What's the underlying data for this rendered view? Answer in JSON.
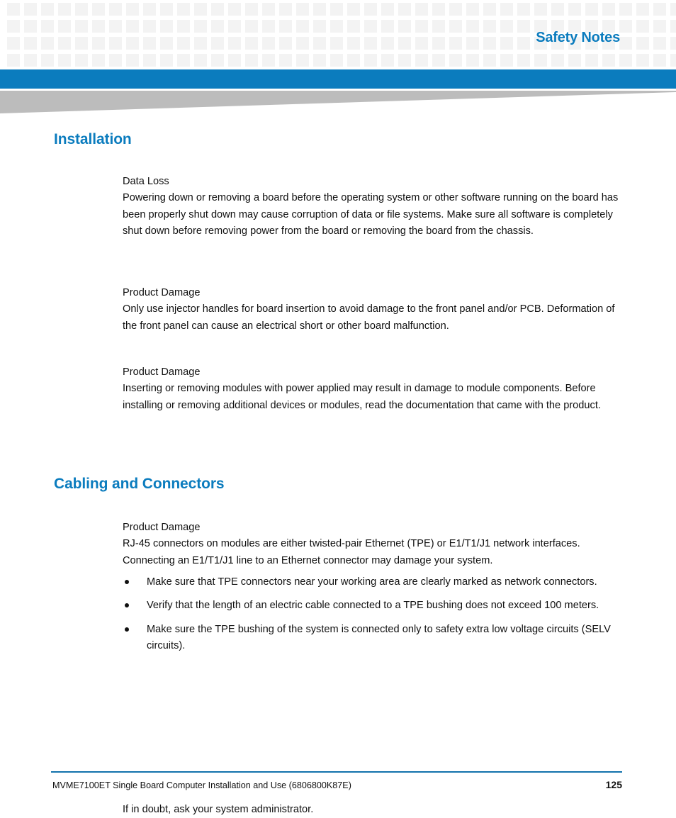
{
  "document": {
    "running_head": "Safety Notes",
    "accent_color": "#0b7cbe",
    "checker_color": "#f3f3f3",
    "wedge_color": "#bcbcbc"
  },
  "sections": [
    {
      "heading": "Installation",
      "notes": [
        {
          "title": "Data Loss",
          "body": "Powering down or removing a board before the operating system or other software running on the board has been properly shut down may cause corruption of data or file systems. Make sure all software is completely shut down before removing power from the board or removing the board from the chassis."
        },
        {
          "title": "Product Damage",
          "body": "Only use injector handles for board insertion to avoid damage to the front panel and/or PCB. Deformation of the front panel can cause an electrical short or other board malfunction."
        },
        {
          "title": "Product Damage",
          "body": "Inserting or removing modules with power applied may result in damage to module components. Before installing or removing additional devices or modules, read the documentation that came with the product."
        }
      ]
    },
    {
      "heading": "Cabling and Connectors",
      "notes": [
        {
          "title": "Product Damage",
          "body": "RJ-45 connectors on modules are either twisted-pair Ethernet (TPE) or E1/T1/J1 network interfaces. Connecting an E1/T1/J1 line to an Ethernet connector may damage your system."
        }
      ],
      "bullets": [
        "Make sure that TPE connectors near your working area are clearly marked as network connectors.",
        "Verify that the length of an electric cable connected to a TPE bushing does not exceed 100 meters.",
        "Make sure the TPE bushing of the system is connected only to safety extra low voltage circuits (SELV circuits)."
      ],
      "closing": "If in doubt, ask your system administrator."
    }
  ],
  "footer": {
    "title": "MVME7100ET Single Board Computer Installation and Use (6806800K87E)",
    "page_number": "125"
  }
}
